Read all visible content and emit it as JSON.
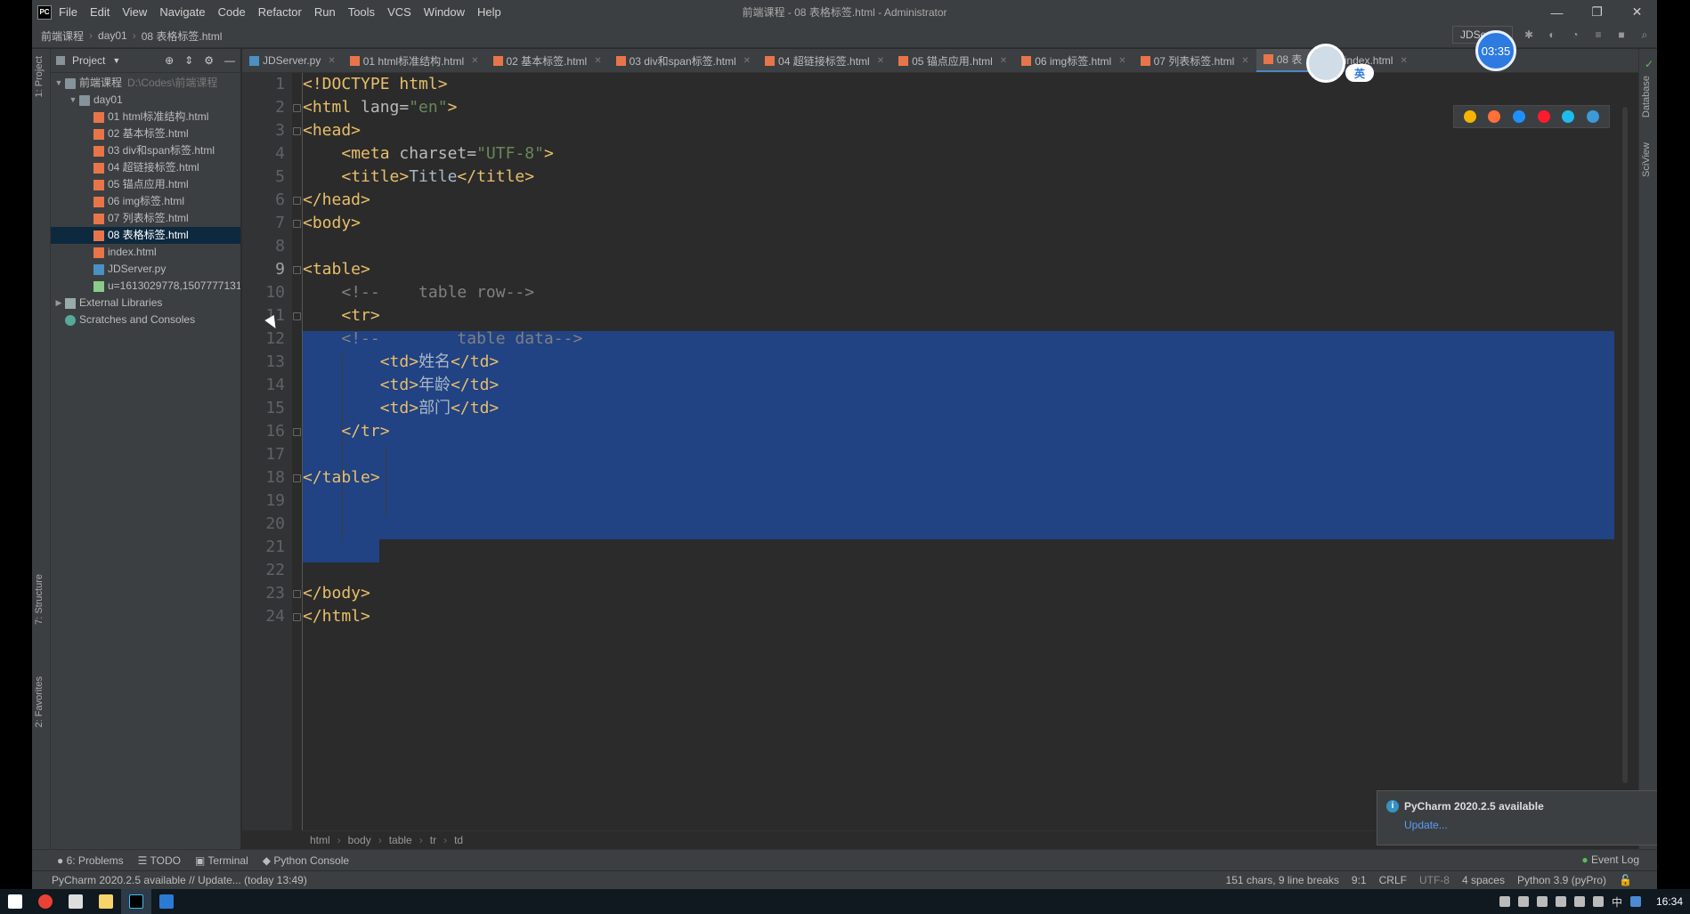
{
  "window": {
    "title": "前端课程 - 08 表格标签.html - Administrator",
    "menu": [
      "File",
      "Edit",
      "View",
      "Navigate",
      "Code",
      "Refactor",
      "Run",
      "Tools",
      "VCS",
      "Window",
      "Help"
    ],
    "controls": [
      "—",
      "❐",
      "✕"
    ]
  },
  "navbar": {
    "crumbs": [
      "前端课程",
      "day01",
      "08 表格标签.html"
    ],
    "run_config": "JDServer"
  },
  "project": {
    "title": "Project",
    "root_name": "前端课程",
    "root_path": "D:\\Codes\\前端课程",
    "folder": "day01",
    "files": [
      "01 html标准结构.html",
      "02 基本标签.html",
      "03 div和span标签.html",
      "04 超链接标签.html",
      "05 锚点应用.html",
      "06 img标签.html",
      "07 列表标签.html",
      "08 表格标签.html"
    ],
    "other_files": [
      "index.html",
      "JDServer.py",
      "u=1613029778,1507777131"
    ],
    "external": "External Libraries",
    "scratches": "Scratches and Consoles"
  },
  "stripes": {
    "left_top": "1: Project",
    "left_mid": "7: Structure",
    "left_bot": "2: Favorites",
    "right_top": "Database",
    "right_mid": "SciView"
  },
  "tabs": [
    {
      "label": "JDServer.py",
      "type": "py"
    },
    {
      "label": "01 html标准结构.html",
      "type": "html"
    },
    {
      "label": "02 基本标签.html",
      "type": "html"
    },
    {
      "label": "03 div和span标签.html",
      "type": "html"
    },
    {
      "label": "04 超链接标签.html",
      "type": "html"
    },
    {
      "label": "05 锚点应用.html",
      "type": "html"
    },
    {
      "label": "06 img标签.html",
      "type": "html"
    },
    {
      "label": "07 列表标签.html",
      "type": "html"
    },
    {
      "label": "08 表",
      "type": "html",
      "active": true
    },
    {
      "label": "index.html",
      "type": "html"
    }
  ],
  "code": [
    {
      "n": "1",
      "parts": [
        [
          "tag",
          "<!DOCTYPE html>"
        ]
      ]
    },
    {
      "n": "2",
      "parts": [
        [
          "tag",
          "<html "
        ],
        [
          "attr",
          "lang="
        ],
        [
          "str",
          "\"en\""
        ],
        [
          "tag",
          ">"
        ]
      ]
    },
    {
      "n": "3",
      "parts": [
        [
          "tag",
          "<head>"
        ]
      ]
    },
    {
      "n": "4",
      "parts": [
        [
          "txt",
          "    "
        ],
        [
          "tag",
          "<meta "
        ],
        [
          "attr",
          "charset="
        ],
        [
          "str",
          "\"UTF-8\""
        ],
        [
          "tag",
          ">"
        ]
      ]
    },
    {
      "n": "5",
      "parts": [
        [
          "txt",
          "    "
        ],
        [
          "tag",
          "<title>"
        ],
        [
          "txt",
          "Title"
        ],
        [
          "tag",
          "</title>"
        ]
      ]
    },
    {
      "n": "6",
      "parts": [
        [
          "tag",
          "</head>"
        ]
      ]
    },
    {
      "n": "7",
      "parts": [
        [
          "tag",
          "<body>"
        ]
      ]
    },
    {
      "n": "8",
      "parts": []
    },
    {
      "n": "9",
      "parts": [
        [
          "tag",
          "<table>"
        ]
      ]
    },
    {
      "n": "10",
      "parts": [
        [
          "txt",
          "    "
        ],
        [
          "cmt",
          "<!--    table row-->"
        ]
      ]
    },
    {
      "n": "11",
      "parts": [
        [
          "txt",
          "    "
        ],
        [
          "tag",
          "<tr>"
        ]
      ]
    },
    {
      "n": "12",
      "parts": [
        [
          "txt",
          "    "
        ],
        [
          "cmt",
          "<!--        table data-->"
        ]
      ]
    },
    {
      "n": "13",
      "parts": [
        [
          "txt",
          "        "
        ],
        [
          "tag",
          "<td>"
        ],
        [
          "txt",
          "姓名"
        ],
        [
          "tag",
          "</td>"
        ]
      ]
    },
    {
      "n": "14",
      "parts": [
        [
          "txt",
          "        "
        ],
        [
          "tag",
          "<td>"
        ],
        [
          "txt",
          "年龄"
        ],
        [
          "tag",
          "</td>"
        ]
      ]
    },
    {
      "n": "15",
      "parts": [
        [
          "txt",
          "        "
        ],
        [
          "tag",
          "<td>"
        ],
        [
          "txt",
          "部门"
        ],
        [
          "tag",
          "</td>"
        ]
      ]
    },
    {
      "n": "16",
      "parts": [
        [
          "txt",
          "    "
        ],
        [
          "tag",
          "</tr>"
        ]
      ]
    },
    {
      "n": "17",
      "parts": []
    },
    {
      "n": "18",
      "parts": [
        [
          "tag",
          "</table>"
        ]
      ]
    },
    {
      "n": "19",
      "parts": []
    },
    {
      "n": "20",
      "parts": []
    },
    {
      "n": "21",
      "parts": []
    },
    {
      "n": "22",
      "parts": []
    },
    {
      "n": "23",
      "parts": [
        [
          "tag",
          "</body>"
        ]
      ]
    },
    {
      "n": "24",
      "parts": [
        [
          "tag",
          "</html>"
        ]
      ]
    }
  ],
  "breadcrumbs": [
    "html",
    "body",
    "table",
    "tr",
    "td"
  ],
  "notification": {
    "title": "PyCharm 2020.2.5 available",
    "link": "Update..."
  },
  "bottom_tools": [
    "6: Problems",
    "TODO",
    "Terminal",
    "Python Console"
  ],
  "event_log": "Event Log",
  "status": {
    "message": "PyCharm 2020.2.5 available // Update... (today 13:49)",
    "selection": "151 chars, 9 line breaks",
    "position": "9:1",
    "line_sep": "CRLF",
    "encoding": "UTF-8",
    "indent": "4 spaces",
    "interpreter": "Python 3.9 (pyPro)"
  },
  "overlay": {
    "timer": "03:35",
    "ime": "英"
  },
  "taskbar": {
    "clock": "16:34",
    "tray_input": "中"
  },
  "colors": {
    "selection": "#214283",
    "tag": "#e8bf6a",
    "string": "#6a8759",
    "comment": "#808080",
    "accent": "#4a88c7"
  }
}
